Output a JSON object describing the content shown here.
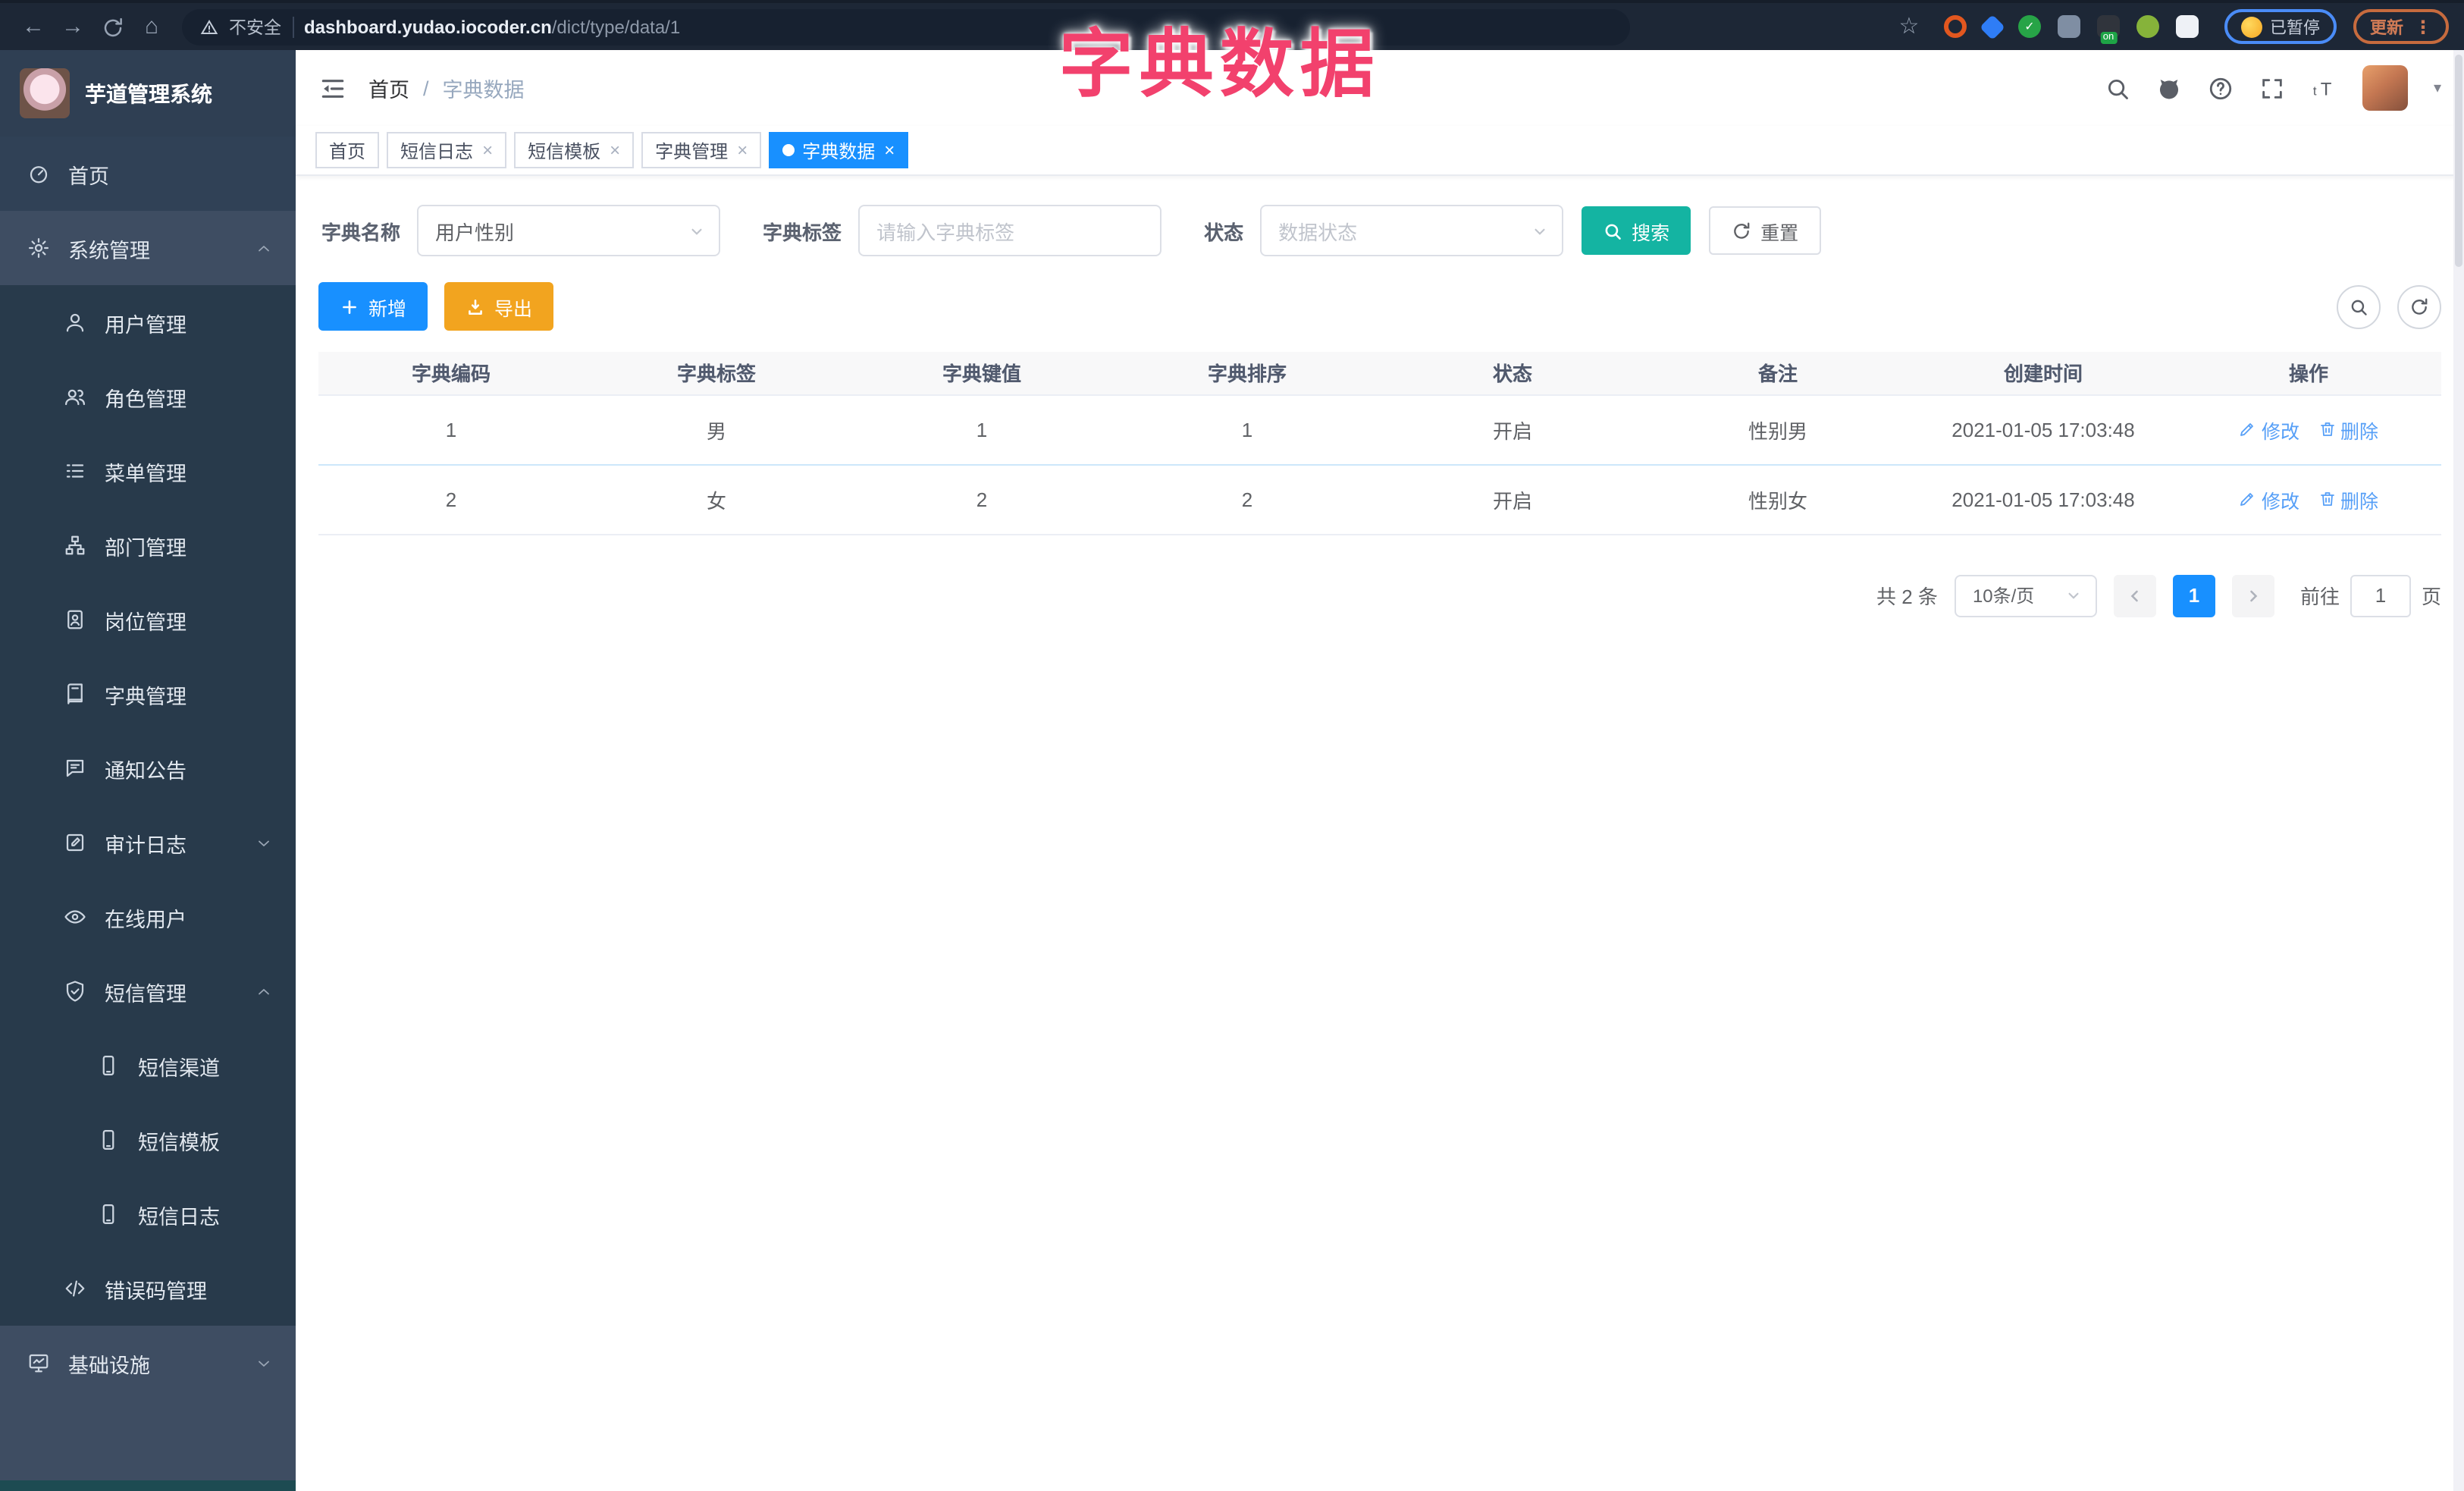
{
  "browser": {
    "security_label": "不安全",
    "url_host": "dashboard.yudao.iocoder.cn",
    "url_path": "/dict/type/data/1",
    "paused_badge_label": "已暂停",
    "update_button_label": "更新",
    "extensions": [
      {
        "id": "extension-orange-ring",
        "shape": "ring",
        "color": "#e2571f"
      },
      {
        "id": "extension-blue-gem",
        "shape": "gem",
        "color": "#2f7df6"
      },
      {
        "id": "extension-green-check",
        "shape": "check",
        "color": "#27a447",
        "glyph": "✓"
      },
      {
        "id": "extension-slider",
        "shape": "square",
        "color": "#7f8ea3"
      },
      {
        "id": "extension-on-badge",
        "shape": "square",
        "color": "#30343c",
        "badge": "on"
      },
      {
        "id": "extension-green-leaf",
        "shape": "circle",
        "color": "#86b33a"
      },
      {
        "id": "extension-puzzle",
        "shape": "square",
        "color": "#eef1f6"
      }
    ]
  },
  "overlay_title": "字典数据",
  "sidebar": {
    "app_title": "芋道管理系统",
    "items": [
      {
        "id": "home",
        "label": "首页",
        "icon": "dashboard-icon",
        "level": 0
      },
      {
        "id": "system",
        "label": "系统管理",
        "icon": "gear-icon",
        "level": 0,
        "caret": "up",
        "highlight": true
      },
      {
        "id": "user",
        "label": "用户管理",
        "icon": "user-icon",
        "level": 1,
        "sub": true
      },
      {
        "id": "role",
        "label": "角色管理",
        "icon": "users-icon",
        "level": 1,
        "sub": true
      },
      {
        "id": "menu",
        "label": "菜单管理",
        "icon": "menu-list-icon",
        "level": 1,
        "sub": true
      },
      {
        "id": "dept",
        "label": "部门管理",
        "icon": "org-tree-icon",
        "level": 1,
        "sub": true
      },
      {
        "id": "post",
        "label": "岗位管理",
        "icon": "badge-icon",
        "level": 1,
        "sub": true
      },
      {
        "id": "dict",
        "label": "字典管理",
        "icon": "dictionary-icon",
        "level": 1,
        "sub": true
      },
      {
        "id": "notice",
        "label": "通知公告",
        "icon": "announcement-icon",
        "level": 1,
        "sub": true
      },
      {
        "id": "audit-log",
        "label": "审计日志",
        "icon": "audit-log-icon",
        "level": 1,
        "sub": true,
        "caret": "down"
      },
      {
        "id": "online-user",
        "label": "在线用户",
        "icon": "online-users-icon",
        "level": 1,
        "sub": true
      },
      {
        "id": "sms",
        "label": "短信管理",
        "icon": "shield-check-icon",
        "level": 1,
        "sub": true,
        "caret": "up"
      },
      {
        "id": "sms-channel",
        "label": "短信渠道",
        "icon": "phone-icon",
        "level": 2,
        "sub": true
      },
      {
        "id": "sms-template",
        "label": "短信模板",
        "icon": "phone-icon",
        "level": 2,
        "sub": true
      },
      {
        "id": "sms-log",
        "label": "短信日志",
        "icon": "phone-icon",
        "level": 2,
        "sub": true
      },
      {
        "id": "error-code",
        "label": "错误码管理",
        "icon": "code-icon",
        "level": 1,
        "sub": true
      },
      {
        "id": "infra",
        "label": "基础设施",
        "icon": "monitor-icon",
        "level": 0,
        "caret": "down",
        "highlight": true
      }
    ]
  },
  "navbar": {
    "breadcrumb": [
      "首页",
      "字典数据"
    ],
    "breadcrumb_separator": "/"
  },
  "tabs": [
    {
      "id": "home",
      "label": "首页",
      "closable": false,
      "active": false
    },
    {
      "id": "sms-log",
      "label": "短信日志",
      "closable": true,
      "active": false
    },
    {
      "id": "sms-template",
      "label": "短信模板",
      "closable": true,
      "active": false
    },
    {
      "id": "dict-management",
      "label": "字典管理",
      "closable": true,
      "active": false
    },
    {
      "id": "dict-data",
      "label": "字典数据",
      "closable": true,
      "active": true
    }
  ],
  "filters": {
    "dict_name_label": "字典名称",
    "dict_name_value": "用户性别",
    "dict_label_label": "字典标签",
    "dict_label_placeholder": "请输入字典标签",
    "status_label": "状态",
    "status_placeholder": "数据状态",
    "search_button": "搜索",
    "reset_button": "重置"
  },
  "toolbar": {
    "add_button": "新增",
    "export_button": "导出"
  },
  "table": {
    "headers": [
      "字典编码",
      "字典标签",
      "字典键值",
      "字典排序",
      "状态",
      "备注",
      "创建时间",
      "操作"
    ],
    "rows": [
      {
        "cells": [
          "1",
          "男",
          "1",
          "1",
          "开启",
          "性别男",
          "2021-01-05 17:03:48"
        ]
      },
      {
        "cells": [
          "2",
          "女",
          "2",
          "2",
          "开启",
          "性别女",
          "2021-01-05 17:03:48"
        ]
      }
    ],
    "edit_action": "修改",
    "delete_action": "删除"
  },
  "pagination": {
    "total_text": "共 2 条",
    "page_size_value": "10条/页",
    "current_page": "1",
    "goto_prefix": "前往",
    "goto_value": "1",
    "goto_suffix": "页"
  },
  "colors": {
    "accent_blue": "#1890ff",
    "search_teal": "#14b4a2",
    "export_orange": "#f2a41f",
    "overlay_pink": "#f2416d",
    "sidebar_bg": "#304156",
    "sidebar_submenu_bg": "#283a4b",
    "sidebar_highlight_bg": "#3e4d62",
    "chrome_bg": "#1d2736",
    "action_link_blue": "#569ff7"
  }
}
